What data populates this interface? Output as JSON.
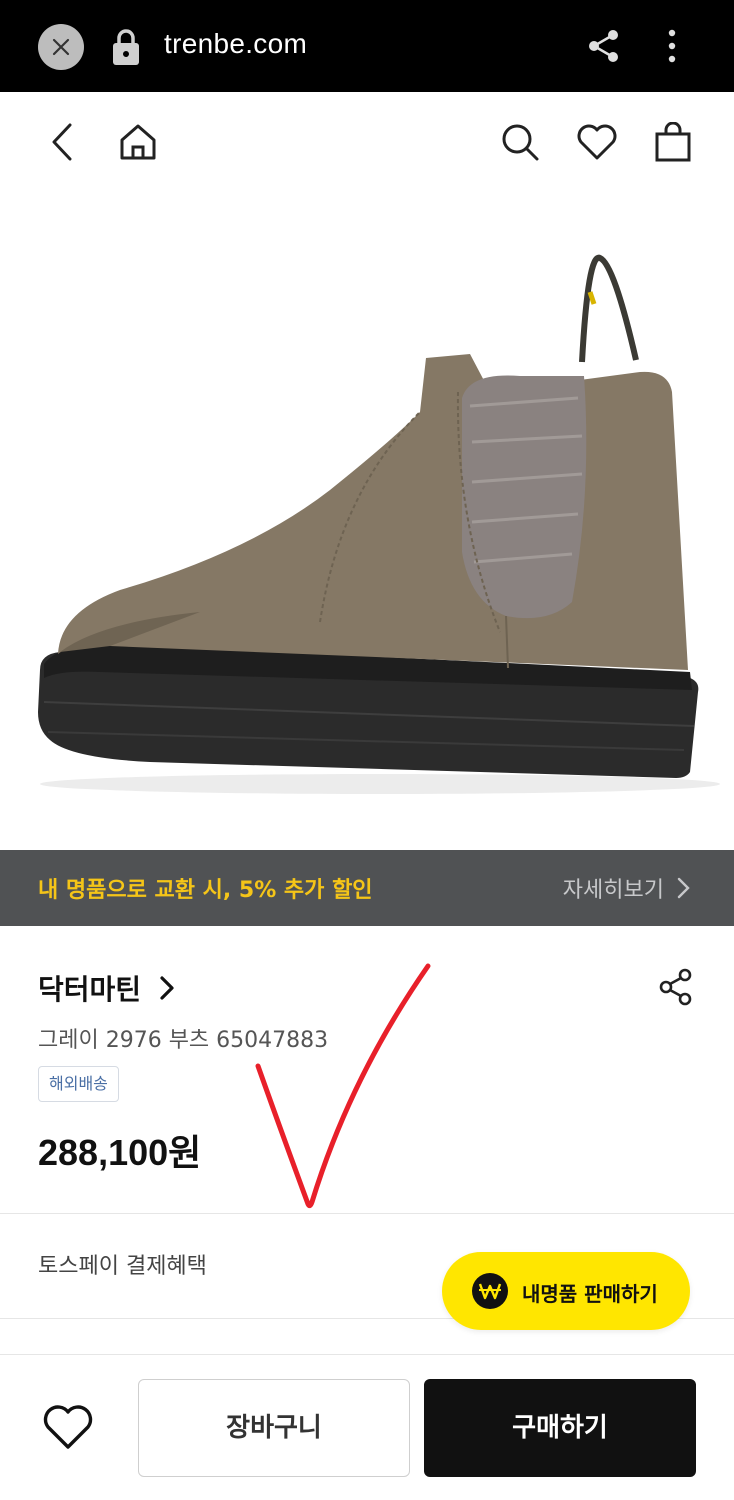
{
  "browser": {
    "url": "trenbe.com",
    "icons": [
      "close-icon",
      "lock-icon",
      "share-icon",
      "more-vert-icon"
    ]
  },
  "header": {
    "icons": [
      "back-icon",
      "home-icon",
      "search-icon",
      "heart-icon",
      "shopping-bag-icon"
    ]
  },
  "promo": {
    "text": "내 명품으로 교환 시, 5% 추가 할인",
    "link_label": "자세히보기",
    "text_color": "#f5c518",
    "background": "#505254"
  },
  "product": {
    "brand": "닥터마틴",
    "name": "그레이 2976 부츠 65047883",
    "badge": "해외배송",
    "price": "288,100원"
  },
  "benefits": {
    "label": "토스페이 결제혜택"
  },
  "fab": {
    "label": "내명품 판매하기",
    "color": "#ffe600"
  },
  "bottom_bar": {
    "cart_label": "장바구니",
    "buy_label": "구매하기"
  },
  "colors": {
    "accent_yellow": "#ffe600",
    "annotation_red": "#e8202a",
    "primary_dark": "#111111"
  }
}
